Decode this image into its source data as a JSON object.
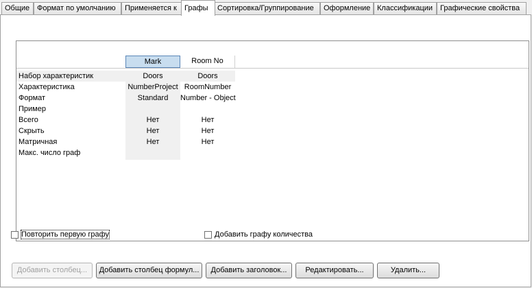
{
  "tabs": [
    {
      "label": "Общие"
    },
    {
      "label": "Формат по умолчанию"
    },
    {
      "label": "Применяется к"
    },
    {
      "label": "Графы"
    },
    {
      "label": "Сортировка/Группирование"
    },
    {
      "label": "Оформление"
    },
    {
      "label": "Классификации"
    },
    {
      "label": "Графические свойства"
    }
  ],
  "active_tab": "Графы",
  "grid": {
    "columns": [
      "Mark",
      "Room No"
    ],
    "selected_column": "Mark",
    "rows": [
      {
        "label": "Набор характеристик",
        "values": [
          "Doors",
          "Doors"
        ]
      },
      {
        "label": "Характеристика",
        "values": [
          "NumberProject",
          "RoomNumber"
        ]
      },
      {
        "label": "Формат",
        "values": [
          "Standard",
          "Number - Object"
        ]
      },
      {
        "label": "Пример",
        "values": [
          "",
          ""
        ]
      },
      {
        "label": "Всего",
        "values": [
          "Нет",
          "Нет"
        ]
      },
      {
        "label": "Скрыть",
        "values": [
          "Нет",
          "Нет"
        ]
      },
      {
        "label": "Матричная",
        "values": [
          "Нет",
          "Нет"
        ]
      },
      {
        "label": "Макс. число граф",
        "values": [
          "",
          ""
        ]
      }
    ]
  },
  "options": {
    "repeat_first_column": {
      "label": "Повторить первую графу",
      "checked": false
    },
    "add_quantity_column": {
      "label": "Добавить графу количества",
      "checked": false
    }
  },
  "buttons": {
    "add_column": {
      "label": "Добавить столбец...",
      "enabled": false
    },
    "add_formula_column": {
      "label": "Добавить столбец формул...",
      "enabled": true
    },
    "add_header": {
      "label": "Добавить заголовок...",
      "enabled": true
    },
    "edit": {
      "label": "Редактировать...",
      "enabled": true
    },
    "delete": {
      "label": "Удалить...",
      "enabled": true
    }
  }
}
